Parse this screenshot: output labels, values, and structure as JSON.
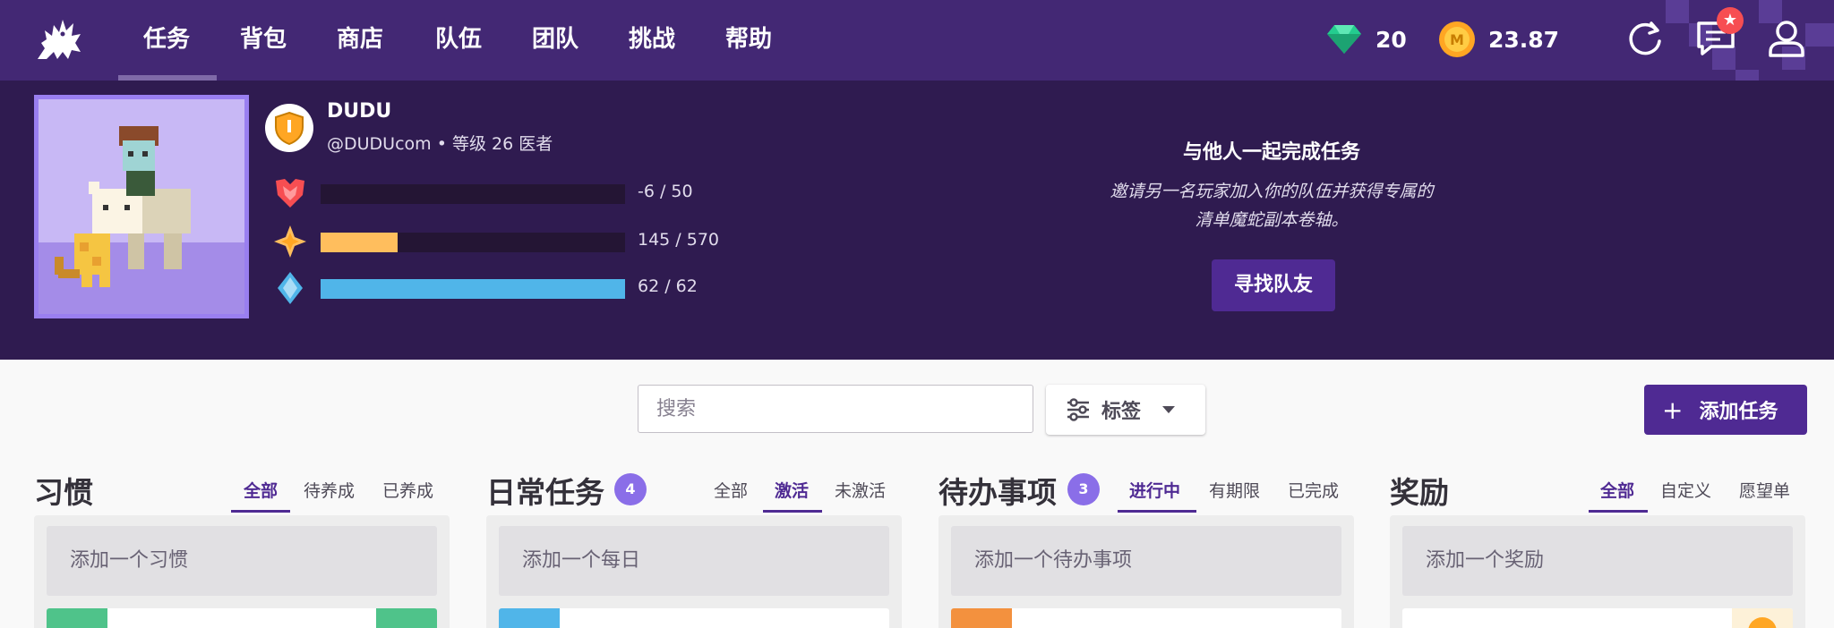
{
  "nav": {
    "items": [
      "任务",
      "背包",
      "商店",
      "队伍",
      "团队",
      "挑战",
      "帮助"
    ],
    "gems": "20",
    "gold": "23.87",
    "notification_badge": "★"
  },
  "user": {
    "name": "DUDU",
    "meta": "@DUDUcom • 等级 26 医者",
    "health": {
      "text": "-6 / 50",
      "fraction": 0.0,
      "color": "#f74e52"
    },
    "experience": {
      "text": "145 / 570",
      "fraction": 0.254,
      "color": "#ffbe5d"
    },
    "mana": {
      "text": "62 / 62",
      "fraction": 1.0,
      "color": "#50b5e9"
    }
  },
  "party": {
    "title": "与他人一起完成任务",
    "desc_line1": "邀请另一名玩家加入你的队伍并获得专属的",
    "desc_line2": "清单魔蛇副本卷轴。",
    "button": "寻找队友"
  },
  "toolbar": {
    "search_placeholder": "搜索",
    "tags_label": "标签",
    "add_task_label": "添加任务",
    "add_task_plus": "+"
  },
  "columns": {
    "habits": {
      "title": "习惯",
      "tabs": [
        "全部",
        "待养成",
        "已养成"
      ],
      "add": "添加一个习惯"
    },
    "dailies": {
      "title": "日常任务",
      "count": "4",
      "tabs": [
        "全部",
        "激活",
        "未激活"
      ],
      "add": "添加一个每日"
    },
    "todos": {
      "title": "待办事项",
      "count": "3",
      "tabs": [
        "进行中",
        "有期限",
        "已完成"
      ],
      "add": "添加一个待办事项"
    },
    "rewards": {
      "title": "奖励",
      "tabs": [
        "全部",
        "自定义",
        "愿望单"
      ],
      "add": "添加一个奖励"
    }
  },
  "colors": {
    "nav_bg": "#432874",
    "header_bg": "#2f1b50",
    "accent": "#4f2a93",
    "habit_green": "#4fc38a",
    "daily_blue": "#50b5e9",
    "todo_orange": "#f3913e"
  }
}
